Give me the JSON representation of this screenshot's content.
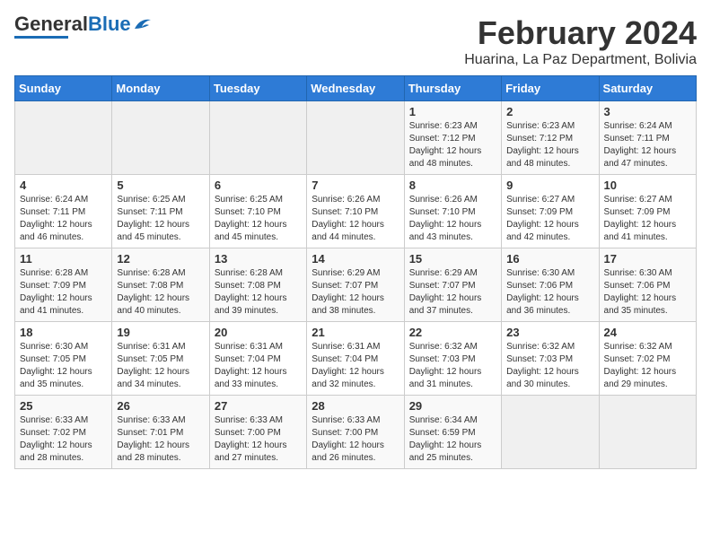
{
  "logo": {
    "text_general": "General",
    "text_blue": "Blue"
  },
  "header": {
    "main_title": "February 2024",
    "subtitle": "Huarina, La Paz Department, Bolivia"
  },
  "weekdays": [
    "Sunday",
    "Monday",
    "Tuesday",
    "Wednesday",
    "Thursday",
    "Friday",
    "Saturday"
  ],
  "weeks": [
    [
      {
        "day": "",
        "info": ""
      },
      {
        "day": "",
        "info": ""
      },
      {
        "day": "",
        "info": ""
      },
      {
        "day": "",
        "info": ""
      },
      {
        "day": "1",
        "info": "Sunrise: 6:23 AM\nSunset: 7:12 PM\nDaylight: 12 hours\nand 48 minutes."
      },
      {
        "day": "2",
        "info": "Sunrise: 6:23 AM\nSunset: 7:12 PM\nDaylight: 12 hours\nand 48 minutes."
      },
      {
        "day": "3",
        "info": "Sunrise: 6:24 AM\nSunset: 7:11 PM\nDaylight: 12 hours\nand 47 minutes."
      }
    ],
    [
      {
        "day": "4",
        "info": "Sunrise: 6:24 AM\nSunset: 7:11 PM\nDaylight: 12 hours\nand 46 minutes."
      },
      {
        "day": "5",
        "info": "Sunrise: 6:25 AM\nSunset: 7:11 PM\nDaylight: 12 hours\nand 45 minutes."
      },
      {
        "day": "6",
        "info": "Sunrise: 6:25 AM\nSunset: 7:10 PM\nDaylight: 12 hours\nand 45 minutes."
      },
      {
        "day": "7",
        "info": "Sunrise: 6:26 AM\nSunset: 7:10 PM\nDaylight: 12 hours\nand 44 minutes."
      },
      {
        "day": "8",
        "info": "Sunrise: 6:26 AM\nSunset: 7:10 PM\nDaylight: 12 hours\nand 43 minutes."
      },
      {
        "day": "9",
        "info": "Sunrise: 6:27 AM\nSunset: 7:09 PM\nDaylight: 12 hours\nand 42 minutes."
      },
      {
        "day": "10",
        "info": "Sunrise: 6:27 AM\nSunset: 7:09 PM\nDaylight: 12 hours\nand 41 minutes."
      }
    ],
    [
      {
        "day": "11",
        "info": "Sunrise: 6:28 AM\nSunset: 7:09 PM\nDaylight: 12 hours\nand 41 minutes."
      },
      {
        "day": "12",
        "info": "Sunrise: 6:28 AM\nSunset: 7:08 PM\nDaylight: 12 hours\nand 40 minutes."
      },
      {
        "day": "13",
        "info": "Sunrise: 6:28 AM\nSunset: 7:08 PM\nDaylight: 12 hours\nand 39 minutes."
      },
      {
        "day": "14",
        "info": "Sunrise: 6:29 AM\nSunset: 7:07 PM\nDaylight: 12 hours\nand 38 minutes."
      },
      {
        "day": "15",
        "info": "Sunrise: 6:29 AM\nSunset: 7:07 PM\nDaylight: 12 hours\nand 37 minutes."
      },
      {
        "day": "16",
        "info": "Sunrise: 6:30 AM\nSunset: 7:06 PM\nDaylight: 12 hours\nand 36 minutes."
      },
      {
        "day": "17",
        "info": "Sunrise: 6:30 AM\nSunset: 7:06 PM\nDaylight: 12 hours\nand 35 minutes."
      }
    ],
    [
      {
        "day": "18",
        "info": "Sunrise: 6:30 AM\nSunset: 7:05 PM\nDaylight: 12 hours\nand 35 minutes."
      },
      {
        "day": "19",
        "info": "Sunrise: 6:31 AM\nSunset: 7:05 PM\nDaylight: 12 hours\nand 34 minutes."
      },
      {
        "day": "20",
        "info": "Sunrise: 6:31 AM\nSunset: 7:04 PM\nDaylight: 12 hours\nand 33 minutes."
      },
      {
        "day": "21",
        "info": "Sunrise: 6:31 AM\nSunset: 7:04 PM\nDaylight: 12 hours\nand 32 minutes."
      },
      {
        "day": "22",
        "info": "Sunrise: 6:32 AM\nSunset: 7:03 PM\nDaylight: 12 hours\nand 31 minutes."
      },
      {
        "day": "23",
        "info": "Sunrise: 6:32 AM\nSunset: 7:03 PM\nDaylight: 12 hours\nand 30 minutes."
      },
      {
        "day": "24",
        "info": "Sunrise: 6:32 AM\nSunset: 7:02 PM\nDaylight: 12 hours\nand 29 minutes."
      }
    ],
    [
      {
        "day": "25",
        "info": "Sunrise: 6:33 AM\nSunset: 7:02 PM\nDaylight: 12 hours\nand 28 minutes."
      },
      {
        "day": "26",
        "info": "Sunrise: 6:33 AM\nSunset: 7:01 PM\nDaylight: 12 hours\nand 28 minutes."
      },
      {
        "day": "27",
        "info": "Sunrise: 6:33 AM\nSunset: 7:00 PM\nDaylight: 12 hours\nand 27 minutes."
      },
      {
        "day": "28",
        "info": "Sunrise: 6:33 AM\nSunset: 7:00 PM\nDaylight: 12 hours\nand 26 minutes."
      },
      {
        "day": "29",
        "info": "Sunrise: 6:34 AM\nSunset: 6:59 PM\nDaylight: 12 hours\nand 25 minutes."
      },
      {
        "day": "",
        "info": ""
      },
      {
        "day": "",
        "info": ""
      }
    ]
  ]
}
